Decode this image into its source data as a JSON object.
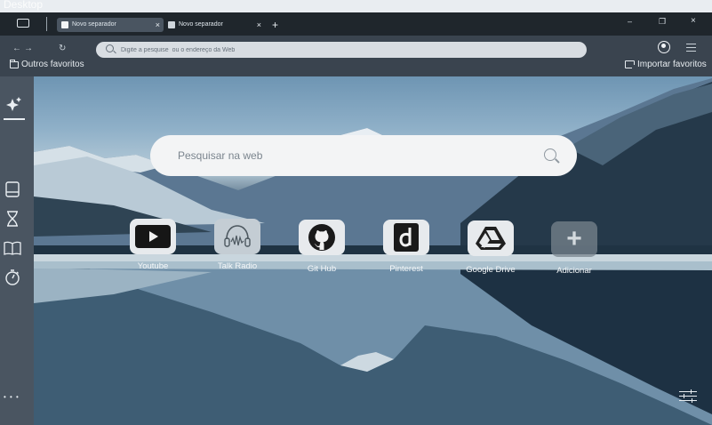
{
  "desktop": {
    "label": "Desktop"
  },
  "tabs": [
    {
      "title": "Novo separador",
      "active": true
    },
    {
      "title": "Novo separador",
      "active": false
    }
  ],
  "window": {
    "minimize": "–",
    "maximize": "❐",
    "close": "×"
  },
  "toolbar": {
    "back": "←",
    "forward": "→",
    "reload": "↻",
    "address_placeholder": "Digite a pesquise  ou o endereço da Web"
  },
  "bookmarks": {
    "other_favorites": "Outros favoritos",
    "import_favorites": "Importar favoritos"
  },
  "newtab": {
    "search_placeholder": "Pesquisar na web",
    "shortcuts": [
      {
        "label": "Youtube",
        "icon": "youtube-icon"
      },
      {
        "label": "Talk Radio",
        "icon": "radio-icon"
      },
      {
        "label": "Git Hub",
        "icon": "github-icon"
      },
      {
        "label": "Pinterest",
        "icon": "d-icon"
      },
      {
        "label": "Google Drive",
        "icon": "google-drive-icon"
      },
      {
        "label": "Adicionar",
        "icon": "plus-icon"
      }
    ]
  },
  "sidebar": {
    "icons": [
      "sparkle-icon",
      "panel-icon",
      "hourglass-icon",
      "book-icon",
      "timer-icon",
      "more-icon"
    ],
    "more": "• • •"
  },
  "colors": {
    "titlebar": "#1f262c",
    "toolbar": "#3a444f",
    "sidebar": "#4a5561",
    "tab_active": "#4a5561"
  }
}
